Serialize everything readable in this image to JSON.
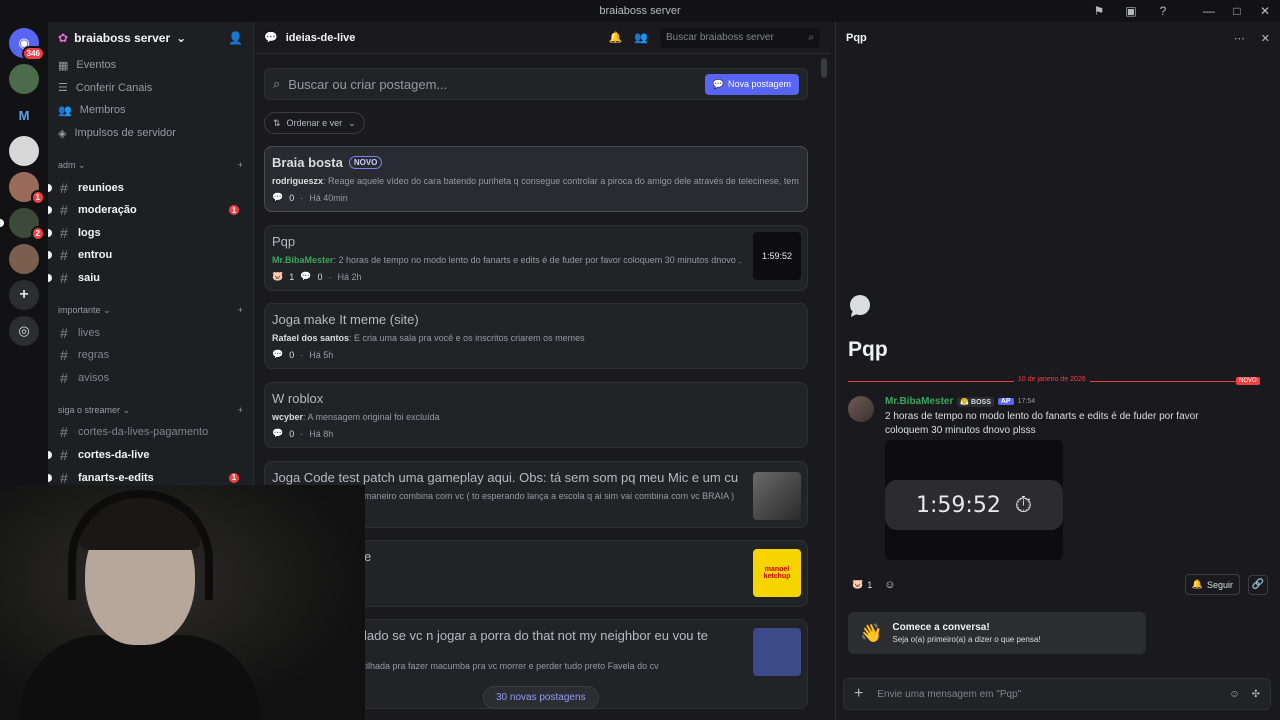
{
  "window": {
    "title": "braiaboss server"
  },
  "guilds": [
    {
      "name": "discord-home",
      "badge": "346"
    },
    {
      "name": "server-2",
      "badge": ""
    },
    {
      "name": "server-m",
      "badge": ""
    },
    {
      "name": "server-4",
      "badge": ""
    },
    {
      "name": "server-5",
      "badge": "1"
    },
    {
      "name": "server-6",
      "badge": "2"
    },
    {
      "name": "server-7",
      "badge": ""
    }
  ],
  "sidebar": {
    "server_name": "braiaboss server",
    "top_items": [
      {
        "label": "Eventos",
        "icon": "calendar-icon"
      },
      {
        "label": "Conferir Canais",
        "icon": "list-icon"
      },
      {
        "label": "Membros",
        "icon": "members-icon"
      },
      {
        "label": "Impulsos de servidor",
        "icon": "boost-icon"
      }
    ],
    "categories": [
      {
        "name": "adm",
        "channels": [
          {
            "label": "reunioes",
            "unread": true,
            "mention": ""
          },
          {
            "label": "moderação",
            "unread": true,
            "mention": "1"
          },
          {
            "label": "logs",
            "unread": true,
            "mention": ""
          },
          {
            "label": "entrou",
            "unread": true,
            "mention": ""
          },
          {
            "label": "saiu",
            "unread": true,
            "mention": ""
          }
        ]
      },
      {
        "name": "importante",
        "channels": [
          {
            "label": "lives",
            "unread": false,
            "mention": ""
          },
          {
            "label": "regras",
            "unread": false,
            "mention": ""
          },
          {
            "label": "avisos",
            "unread": false,
            "mention": ""
          }
        ]
      },
      {
        "name": "siga o streamer",
        "channels": [
          {
            "label": "cortes-da-lives-pagamento",
            "unread": false,
            "mention": ""
          },
          {
            "label": "cortes-da-live",
            "unread": true,
            "mention": ""
          },
          {
            "label": "fanarts-e-edits",
            "unread": true,
            "mention": "1"
          }
        ]
      }
    ]
  },
  "forum": {
    "channel_name": "ideias-de-live",
    "search_placeholder": "Buscar braiaboss server",
    "post_search_placeholder": "Buscar ou criar postagem...",
    "new_post_label": "Nova postagem",
    "sort_label": "Ordenar e ver",
    "new_posts_pill": "30 novas postagens",
    "posts": [
      {
        "title": "Braia bosta",
        "tag": "NOVO",
        "author": "rodrigueszx",
        "preview": "Reage aquele vídeo do cara batendo punheta q consegue controlar a piroca do amigo dele através de telecinese, tem ...",
        "reactions": "",
        "comments": "0",
        "time": "Há 40min",
        "thumb": ""
      },
      {
        "title": "Pqp",
        "tag": "",
        "author": "Mr.BibaMester",
        "preview": "2 horas de tempo no modo lento do fanarts e edits é de fuder por favor coloquem 30 minutos dnovo ...",
        "reactions": "1",
        "comments": "0",
        "time": "Há 2h",
        "thumb": "1:59:52"
      },
      {
        "title": "Joga make It meme (site)",
        "tag": "",
        "author": "Rafael dos santos",
        "preview": "E cria uma sala pra você e os inscritos criarem os memes",
        "reactions": "",
        "comments": "0",
        "time": "Há 5h",
        "thumb": ""
      },
      {
        "title": "W roblox",
        "tag": "",
        "author": "wcyber",
        "preview": "A mensagem original foi excluída",
        "reactions": "",
        "comments": "0",
        "time": "Há 8h",
        "thumb": ""
      },
      {
        "title": "Joga Code test patch uma gameplay aqui. Obs: tá sem som pq meu Mic e um cu",
        "tag": "",
        "author": "",
        "preview": "maneiro combina com vc ( to esperando lança a escola q ai sim vai combina com vc BRAIA )",
        "reactions": "",
        "comments": "",
        "time": "",
        "thumb": ""
      },
      {
        "title": "e",
        "tag": "",
        "author": "",
        "preview": "",
        "reactions": "",
        "comments": "",
        "time": "",
        "thumb": "manoel ketchup"
      },
      {
        "title": "lado se vc n jogar a porra do that not my neighbor eu vou te",
        "tag": "",
        "author": "",
        "preview": "ncruzilhada pra fazer macumba pra vc morrer e perder tudo preto Favela do cv",
        "reactions": "",
        "comments": "",
        "time": "",
        "thumb": ""
      }
    ]
  },
  "thread": {
    "title": "Pqp",
    "date_divider": "10 de janeiro de 2026",
    "new_label": "NOVO",
    "message": {
      "author": "Mr.BibaMester",
      "badge_text": "BOSS",
      "tag": "AP",
      "time": "17:54",
      "text": "2 horas de tempo no modo lento do fanarts e edits é de fuder por favor coloquem 30 minutos dnovo plsss",
      "image_timer": "1:59:52"
    },
    "reaction_count": "1",
    "follow_label": "Seguir",
    "cta_title": "Comece a conversa!",
    "cta_subtitle": "Seja o(a) primeiro(a) a dizer o que pensa!",
    "composer_placeholder": "Envie uma mensagem em \"Pqp\""
  }
}
